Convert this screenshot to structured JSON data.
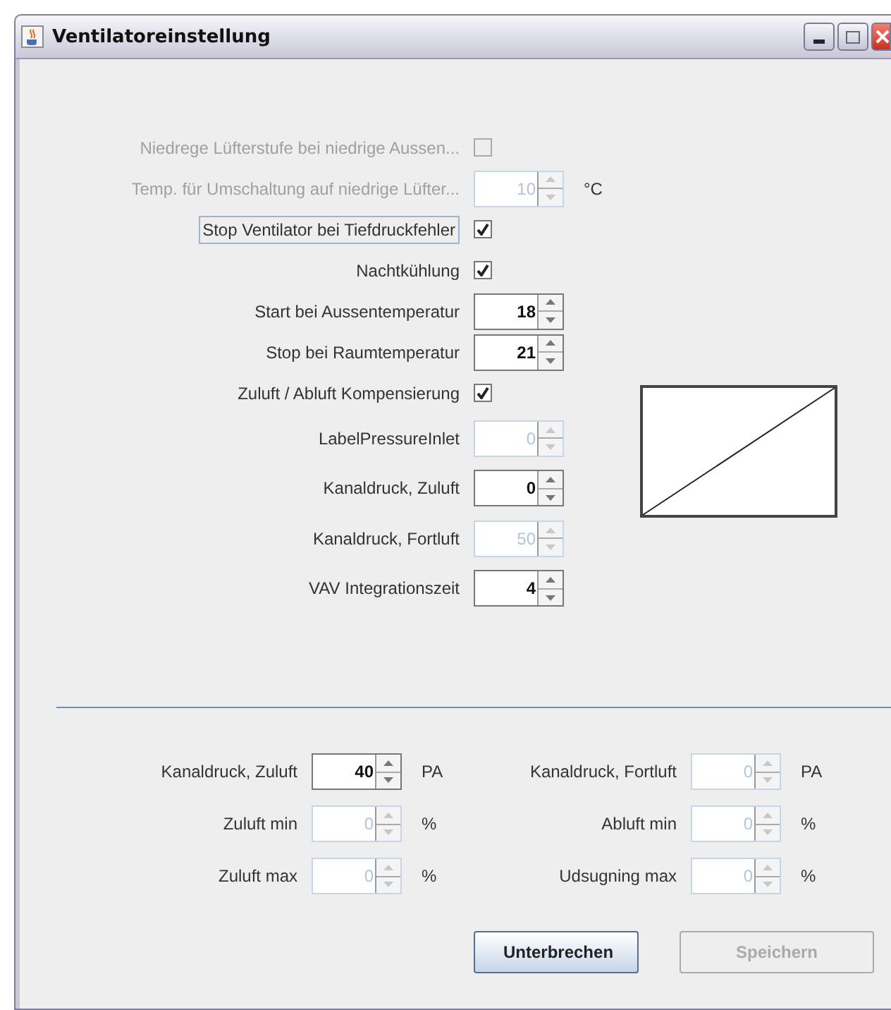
{
  "window": {
    "title": "Ventilatoreinstellung"
  },
  "settings": [
    {
      "kind": "checkbox",
      "label": "Niedrege Lüfterstufe bei niedrige Aussen...",
      "checked": false,
      "disabled": true,
      "focused": false
    },
    {
      "kind": "spinner",
      "label": "Temp. für Umschaltung auf niedrige Lüfter...",
      "value": "10",
      "unit": "°C",
      "disabled": true
    },
    {
      "kind": "checkbox",
      "label": "Stop Ventilator bei Tiefdruckfehler",
      "checked": true,
      "disabled": false,
      "focused": true
    },
    {
      "kind": "checkbox",
      "label": "Nachtkühlung",
      "checked": true,
      "disabled": false,
      "focused": false
    },
    {
      "kind": "spinner",
      "label": "Start bei Aussentemperatur",
      "value": "18",
      "disabled": false
    },
    {
      "kind": "spinner",
      "label": "Stop bei Raumtemperatur",
      "value": "21",
      "disabled": false
    },
    {
      "kind": "checkbox",
      "label": "Zuluft / Abluft Kompensierung",
      "checked": true,
      "disabled": false,
      "focused": false
    }
  ],
  "pressure_settings": [
    {
      "label": "LabelPressureInlet",
      "value": "0",
      "disabled": true
    },
    {
      "label": "Kanaldruck, Zuluft",
      "value": "0",
      "disabled": false
    },
    {
      "label": "Kanaldruck, Fortluft",
      "value": "50",
      "disabled": true
    },
    {
      "label": "VAV Integrationszeit",
      "value": "4",
      "disabled": false
    }
  ],
  "limits": [
    {
      "label": "Kanaldruck, Zuluft",
      "value": "40",
      "unit": "PA",
      "disabled": false
    },
    {
      "label": "Kanaldruck, Fortluft",
      "value": "0",
      "unit": "PA",
      "disabled": true
    },
    {
      "label": "Zuluft min",
      "value": "0",
      "unit": "%",
      "disabled": true
    },
    {
      "label": "Abluft min",
      "value": "0",
      "unit": "%",
      "disabled": true
    },
    {
      "label": "Zuluft max",
      "value": "0",
      "unit": "%",
      "disabled": true
    },
    {
      "label": "Udsugning max",
      "value": "0",
      "unit": "%",
      "disabled": true
    }
  ],
  "buttons": [
    {
      "label": "Unterbrechen",
      "disabled": false
    },
    {
      "label": "Speichern",
      "disabled": true
    }
  ]
}
